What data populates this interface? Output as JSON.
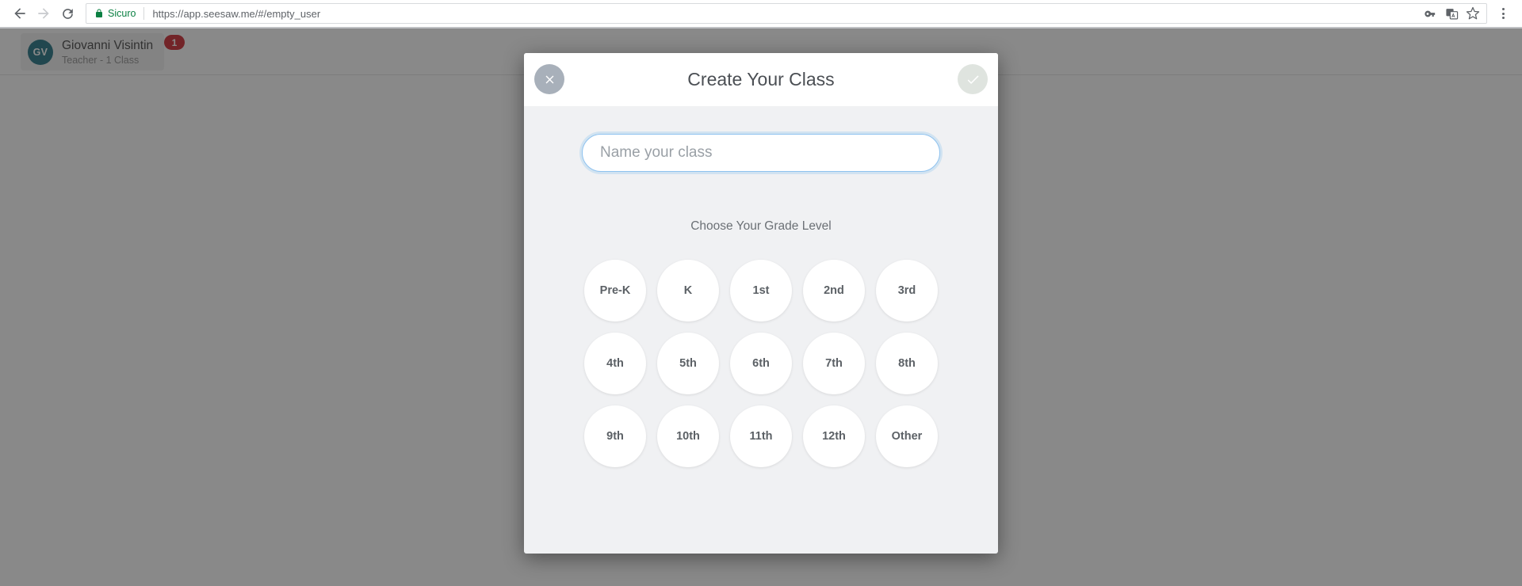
{
  "browser": {
    "back_icon": "arrow-left-icon",
    "forward_icon": "arrow-right-icon",
    "reload_icon": "reload-icon",
    "security_label": "Sicuro",
    "url": "https://app.seesaw.me/#/empty_user",
    "lock_icon": "lock-icon",
    "password_icon": "key-icon",
    "translate_icon": "translate-icon",
    "bookmark_icon": "star-icon",
    "menu_icon": "three-dot-menu-icon"
  },
  "app": {
    "profile": {
      "initials": "GV",
      "name": "Giovanni Visintin",
      "role": "Teacher - 1 Class",
      "badge_count": "1"
    }
  },
  "modal": {
    "title": "Create Your Class",
    "close_icon": "close-icon",
    "confirm_icon": "check-icon",
    "class_name": {
      "value": "",
      "placeholder": "Name your class"
    },
    "grade_section_label": "Choose Your Grade Level",
    "grades": [
      "Pre-K",
      "K",
      "1st",
      "2nd",
      "3rd",
      "4th",
      "5th",
      "6th",
      "7th",
      "8th",
      "9th",
      "10th",
      "11th",
      "12th",
      "Other"
    ]
  },
  "colors": {
    "accent_blue": "#8ec2ef",
    "avatar_teal": "#1a6e7e",
    "badge_red": "#cc2028",
    "secure_green": "#0b8043",
    "close_gray": "#a8b0ba",
    "confirm_gray": "#dfe4df",
    "modal_bg": "#f0f1f3"
  }
}
